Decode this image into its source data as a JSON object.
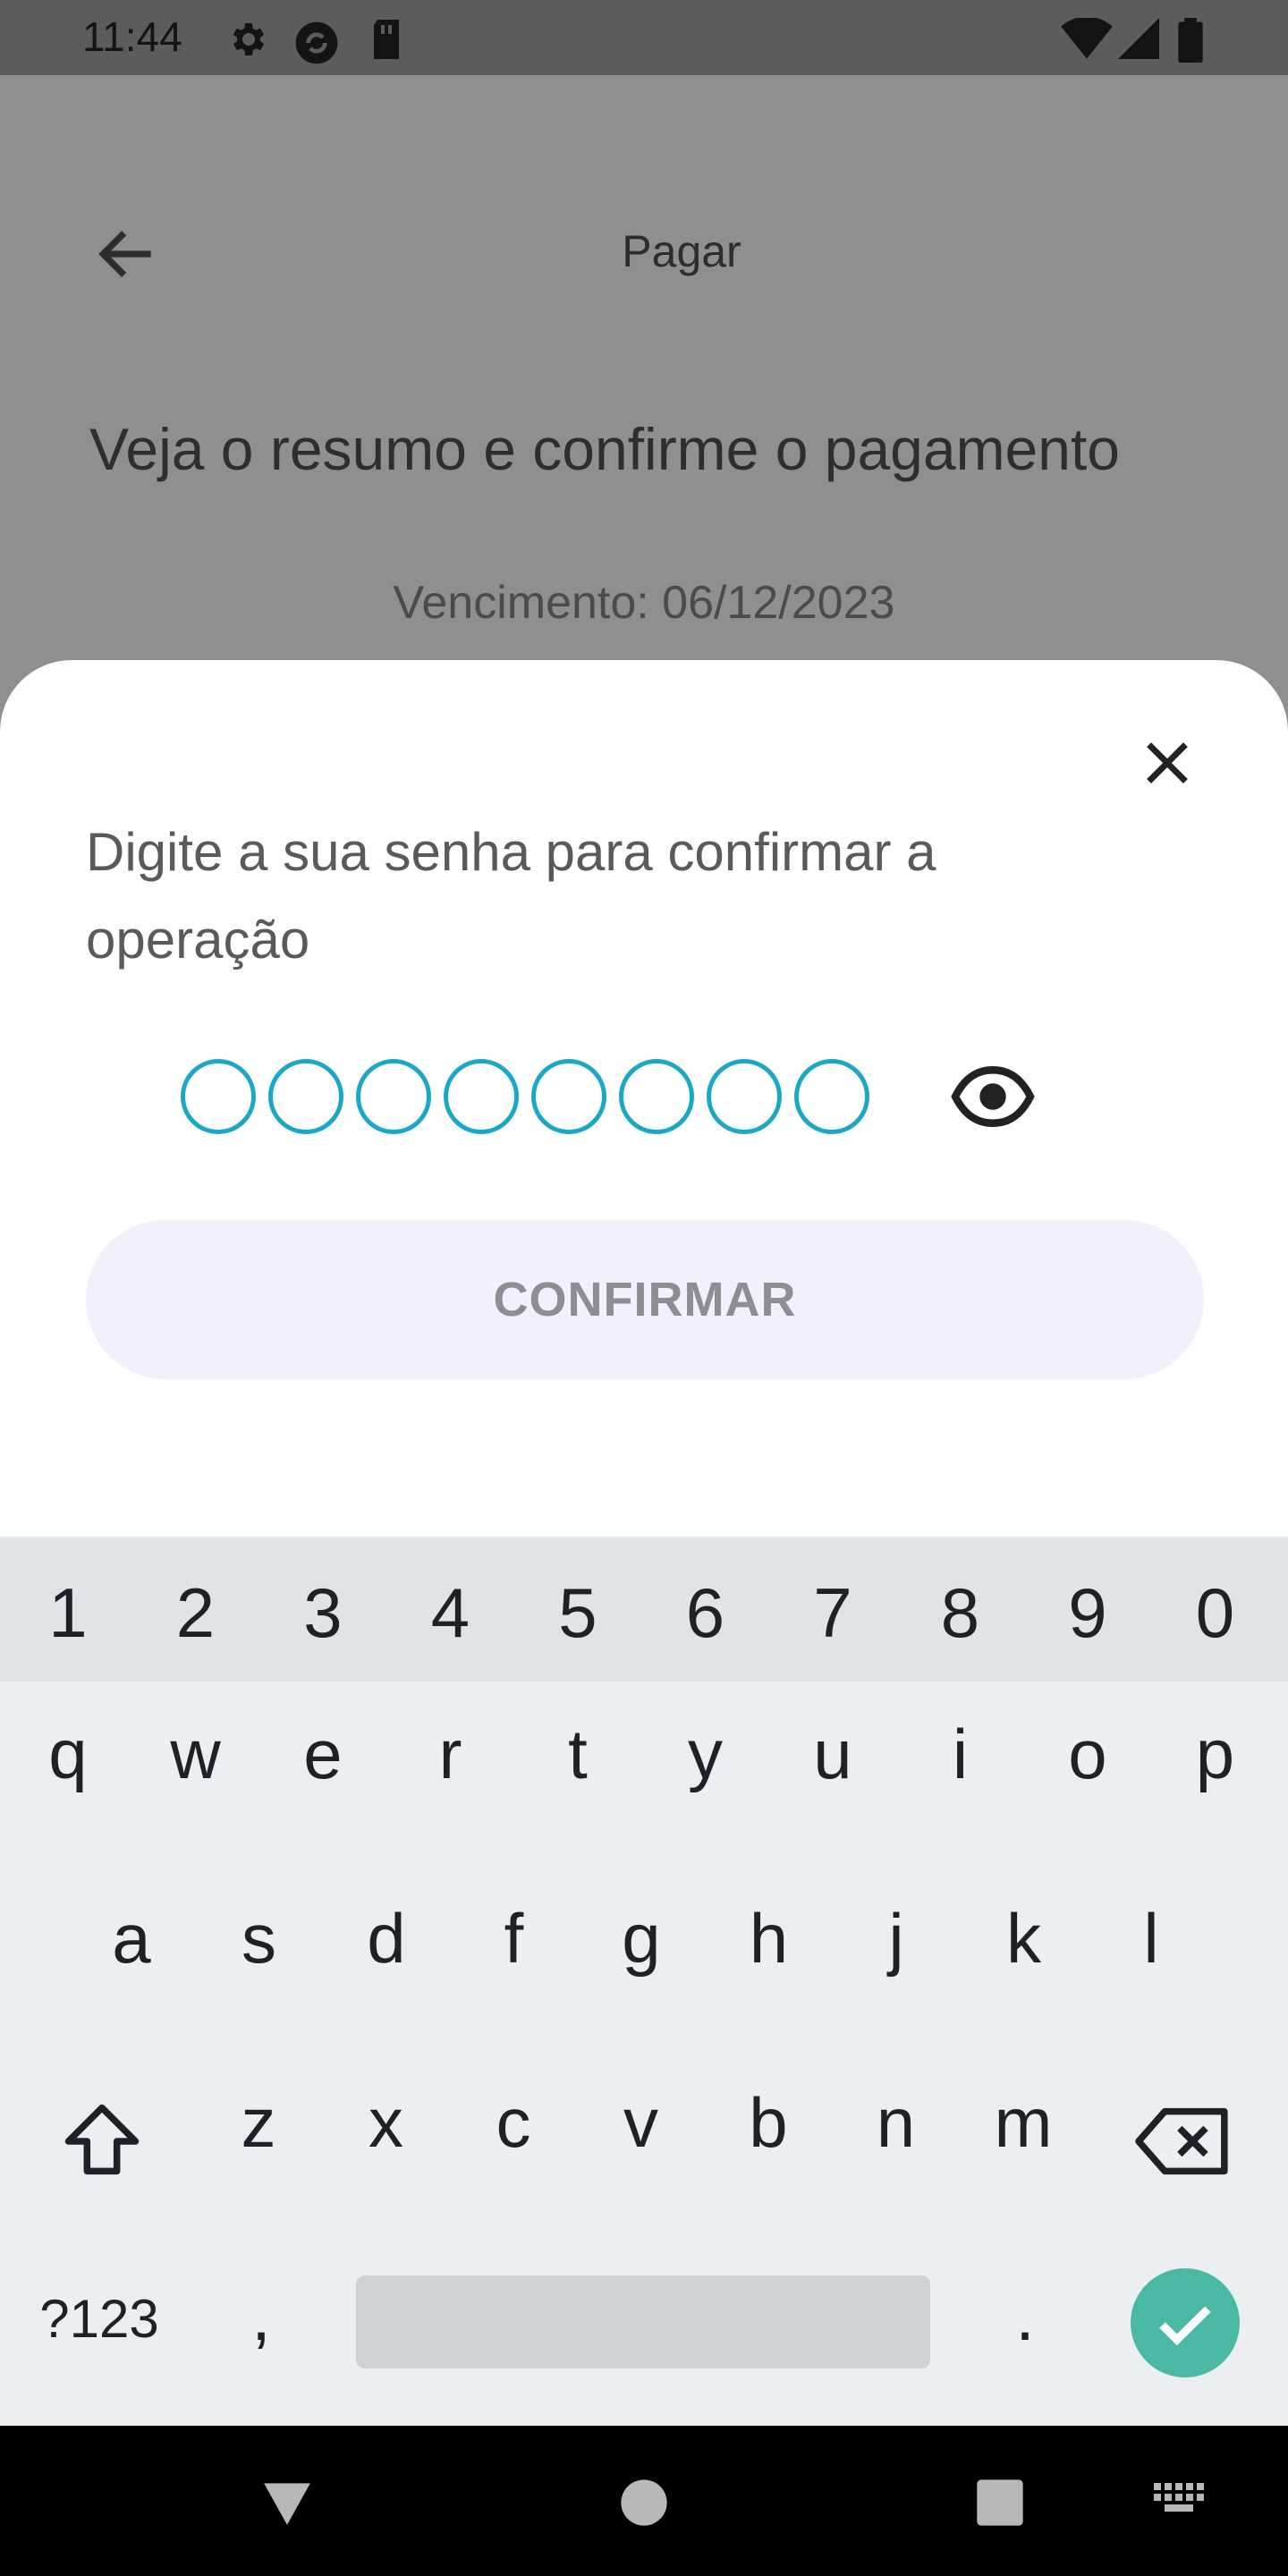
{
  "status_bar": {
    "time": "11:44",
    "icons_left": [
      "gear-icon",
      "sync-icon",
      "sd-card-icon"
    ],
    "icons_right": [
      "wifi-icon",
      "signal-icon",
      "battery-icon"
    ]
  },
  "page": {
    "title": "Pagar",
    "subtitle": "Veja o resumo e confirme o pagamento",
    "due_date": "Vencimento: 06/12/2023"
  },
  "sheet": {
    "prompt": "Digite a sua senha para confirmar a operação",
    "pin_length": 8,
    "confirm_label": "CONFIRMAR",
    "accent_color": "#1ba8c7"
  },
  "keyboard": {
    "numbers": [
      "1",
      "2",
      "3",
      "4",
      "5",
      "6",
      "7",
      "8",
      "9",
      "0"
    ],
    "row1": [
      "q",
      "w",
      "e",
      "r",
      "t",
      "y",
      "u",
      "i",
      "o",
      "p"
    ],
    "row2": [
      "a",
      "s",
      "d",
      "f",
      "g",
      "h",
      "j",
      "k",
      "l"
    ],
    "row3": [
      "z",
      "x",
      "c",
      "v",
      "b",
      "n",
      "m"
    ],
    "symbols_label": "?123",
    "comma": ",",
    "period": ".",
    "enter_color": "#49b8a4"
  }
}
